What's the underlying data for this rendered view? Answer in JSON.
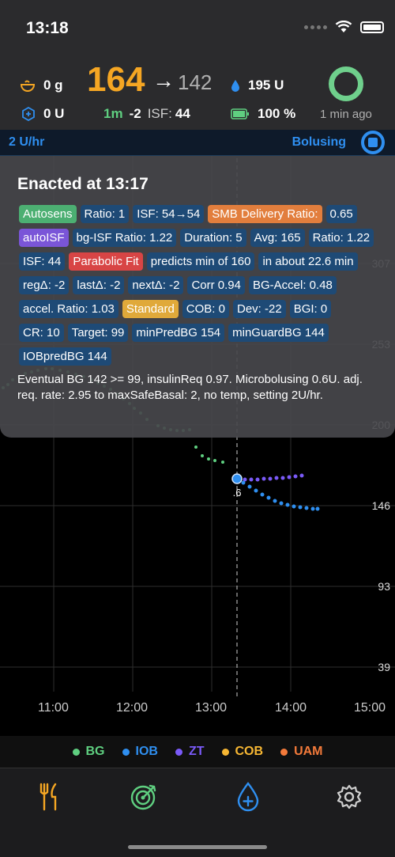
{
  "status": {
    "time": "13:18"
  },
  "header": {
    "carbs": "0 g",
    "iob": "0 U",
    "bg": "164",
    "bg_arrow": "→",
    "eventual_bg": "142",
    "delta_time": "1m",
    "delta": "-2",
    "isf_label": "ISF:",
    "isf": "44",
    "reservoir": "195 U",
    "battery": "100 %",
    "loop_ago": "1 min ago"
  },
  "basal": {
    "rate": "2 U/hr",
    "bolus_status": "Bolusing"
  },
  "popup": {
    "title": "Enacted at 13:17",
    "chips": [
      {
        "text": "Autosens",
        "color": "green"
      },
      {
        "text": "Ratio: 1",
        "color": "blue"
      },
      {
        "text": "ISF: 54→54",
        "color": "blue"
      },
      {
        "text": "SMB Delivery Ratio:",
        "color": "orange"
      },
      {
        "text": "0.65",
        "color": "blue"
      },
      {
        "text": "autoISF",
        "color": "purple"
      },
      {
        "text": "bg-ISF Ratio: 1.22",
        "color": "blue"
      },
      {
        "text": "Duration: 5",
        "color": "blue"
      },
      {
        "text": "Avg: 165",
        "color": "blue"
      },
      {
        "text": "Ratio: 1.22",
        "color": "blue"
      },
      {
        "text": "ISF: 44",
        "color": "blue"
      },
      {
        "text": "Parabolic Fit",
        "color": "red"
      },
      {
        "text": "predicts min of 160",
        "color": "blue"
      },
      {
        "text": "in about 22.6 min",
        "color": "blue"
      },
      {
        "text": "regΔ: -2",
        "color": "blue"
      },
      {
        "text": "lastΔ: -2",
        "color": "blue"
      },
      {
        "text": "nextΔ: -2",
        "color": "blue"
      },
      {
        "text": "Corr 0.94",
        "color": "blue"
      },
      {
        "text": "BG-Accel: 0.48",
        "color": "blue"
      },
      {
        "text": "accel. Ratio: 1.03",
        "color": "blue"
      },
      {
        "text": "Standard",
        "color": "yellow"
      },
      {
        "text": "COB: 0",
        "color": "blue"
      },
      {
        "text": "Dev: -22",
        "color": "blue"
      },
      {
        "text": "BGI: 0",
        "color": "blue"
      },
      {
        "text": "CR: 10",
        "color": "blue"
      },
      {
        "text": "Target: 99",
        "color": "blue"
      },
      {
        "text": "minPredBG 154",
        "color": "blue"
      },
      {
        "text": "minGuardBG 144",
        "color": "blue"
      },
      {
        "text": "IOBpredBG 144",
        "color": "blue"
      }
    ],
    "reason": "Eventual BG 142 >= 99,  insulinReq 0.97. Microbolusing 0.6U. adj. req. rate: 2.95 to maxSafeBasal: 2, no temp, setting 2U/hr."
  },
  "chart": {
    "y_ticks": [
      "307",
      "253",
      "200",
      "146",
      "93",
      "39"
    ],
    "x_ticks": [
      "11:00",
      "12:00",
      "13:00",
      "14:00",
      "15:00"
    ],
    "bolus_marker": ".6",
    "colors": {
      "bg": "#5fcf80",
      "iob": "#2f8ff0",
      "zt": "#7a5af8",
      "cob": "#f7b733",
      "uam": "#f37a3a"
    }
  },
  "legend": [
    "BG",
    "IOB",
    "ZT",
    "COB",
    "UAM"
  ],
  "tabs": [
    "carbs-icon",
    "target-icon",
    "bolus-icon",
    "settings-icon"
  ]
}
